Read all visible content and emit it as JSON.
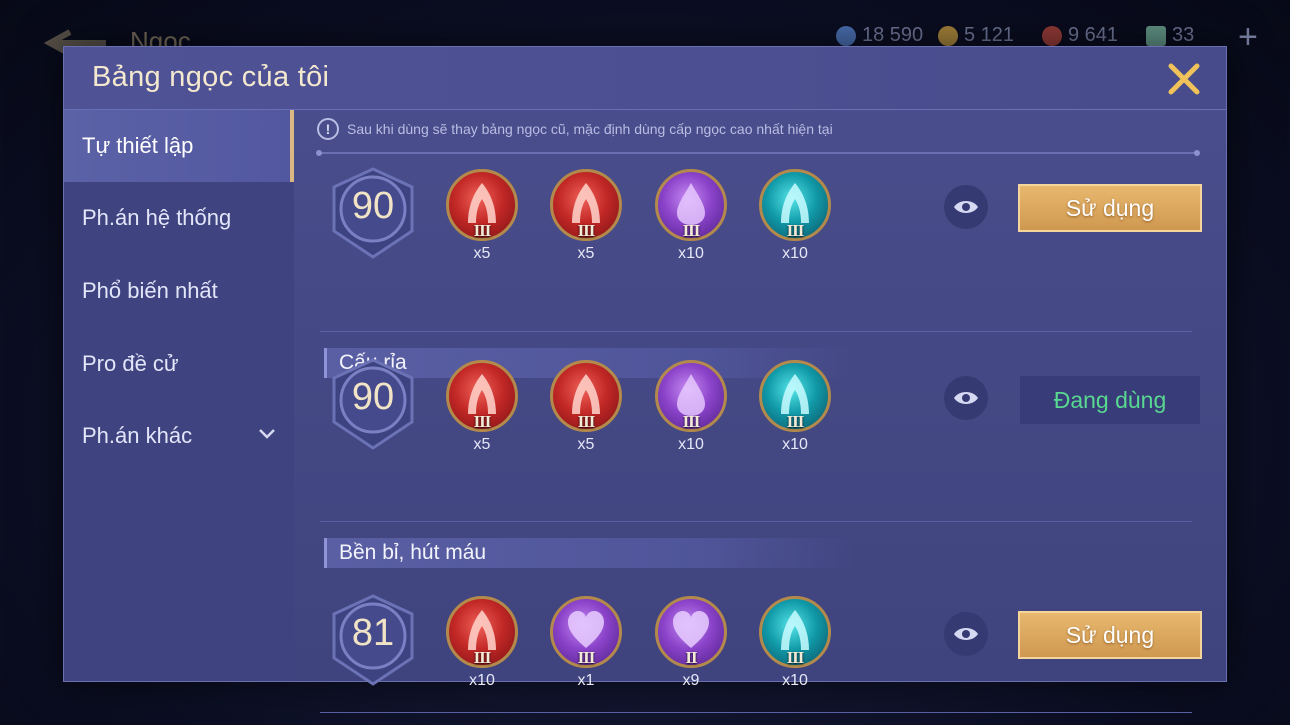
{
  "background": {
    "screen_title": "Ngọc",
    "resources": [
      {
        "icon": "gem-token-icon",
        "value": "18 590",
        "color": "#5e8ee0"
      },
      {
        "icon": "gold-coin-icon",
        "value": "5 121",
        "color": "#d8a944"
      },
      {
        "icon": "ruby-icon",
        "value": "9 641",
        "color": "#c04a3e"
      },
      {
        "icon": "ticket-icon",
        "value": "33",
        "color": "#7ec0a8"
      }
    ]
  },
  "modal": {
    "title": "Bảng ngọc của tôi",
    "notice": "Sau khi dùng sẽ thay bảng ngọc cũ, mặc định dùng cấp ngọc cao nhất hiện tại"
  },
  "sidebar": {
    "items": [
      {
        "label": "Tự thiết lập",
        "active": true
      },
      {
        "label": "Ph.án hệ thống",
        "active": false
      },
      {
        "label": "Phổ biến nhất",
        "active": false
      },
      {
        "label": "Pro đề cử",
        "active": false
      },
      {
        "label": "Ph.án khác",
        "active": false,
        "has_dropdown": true
      }
    ]
  },
  "pages": [
    {
      "name": "",
      "level": "90",
      "action": "Sử dụng",
      "in_use": false,
      "gems": [
        {
          "color": "red",
          "symbol": "arch",
          "tier": "III",
          "count": "x5"
        },
        {
          "color": "red",
          "symbol": "arch",
          "tier": "III",
          "count": "x5"
        },
        {
          "color": "purple",
          "symbol": "drop",
          "tier": "III",
          "count": "x10"
        },
        {
          "color": "teal",
          "symbol": "arch",
          "tier": "III",
          "count": "x10"
        }
      ]
    },
    {
      "name": "Cấu rỉa",
      "level": "90",
      "action": "Đang dùng",
      "in_use": true,
      "gems": [
        {
          "color": "red",
          "symbol": "arch",
          "tier": "III",
          "count": "x5"
        },
        {
          "color": "red",
          "symbol": "arch",
          "tier": "III",
          "count": "x5"
        },
        {
          "color": "purple",
          "symbol": "drop",
          "tier": "III",
          "count": "x10"
        },
        {
          "color": "teal",
          "symbol": "arch",
          "tier": "III",
          "count": "x10"
        }
      ]
    },
    {
      "name": "Bền bỉ, hút máu",
      "level": "81",
      "action": "Sử dụng",
      "in_use": false,
      "gems": [
        {
          "color": "red",
          "symbol": "arch",
          "tier": "III",
          "count": "x10"
        },
        {
          "color": "purple",
          "symbol": "heart",
          "tier": "III",
          "count": "x1"
        },
        {
          "color": "purple",
          "symbol": "heart",
          "tier": "II",
          "count": "x9"
        },
        {
          "color": "teal",
          "symbol": "arch",
          "tier": "III",
          "count": "x10"
        }
      ]
    }
  ],
  "colors": {
    "accent_gold": "#d9b883",
    "in_use_green": "#58d890",
    "panel": "#454985"
  }
}
